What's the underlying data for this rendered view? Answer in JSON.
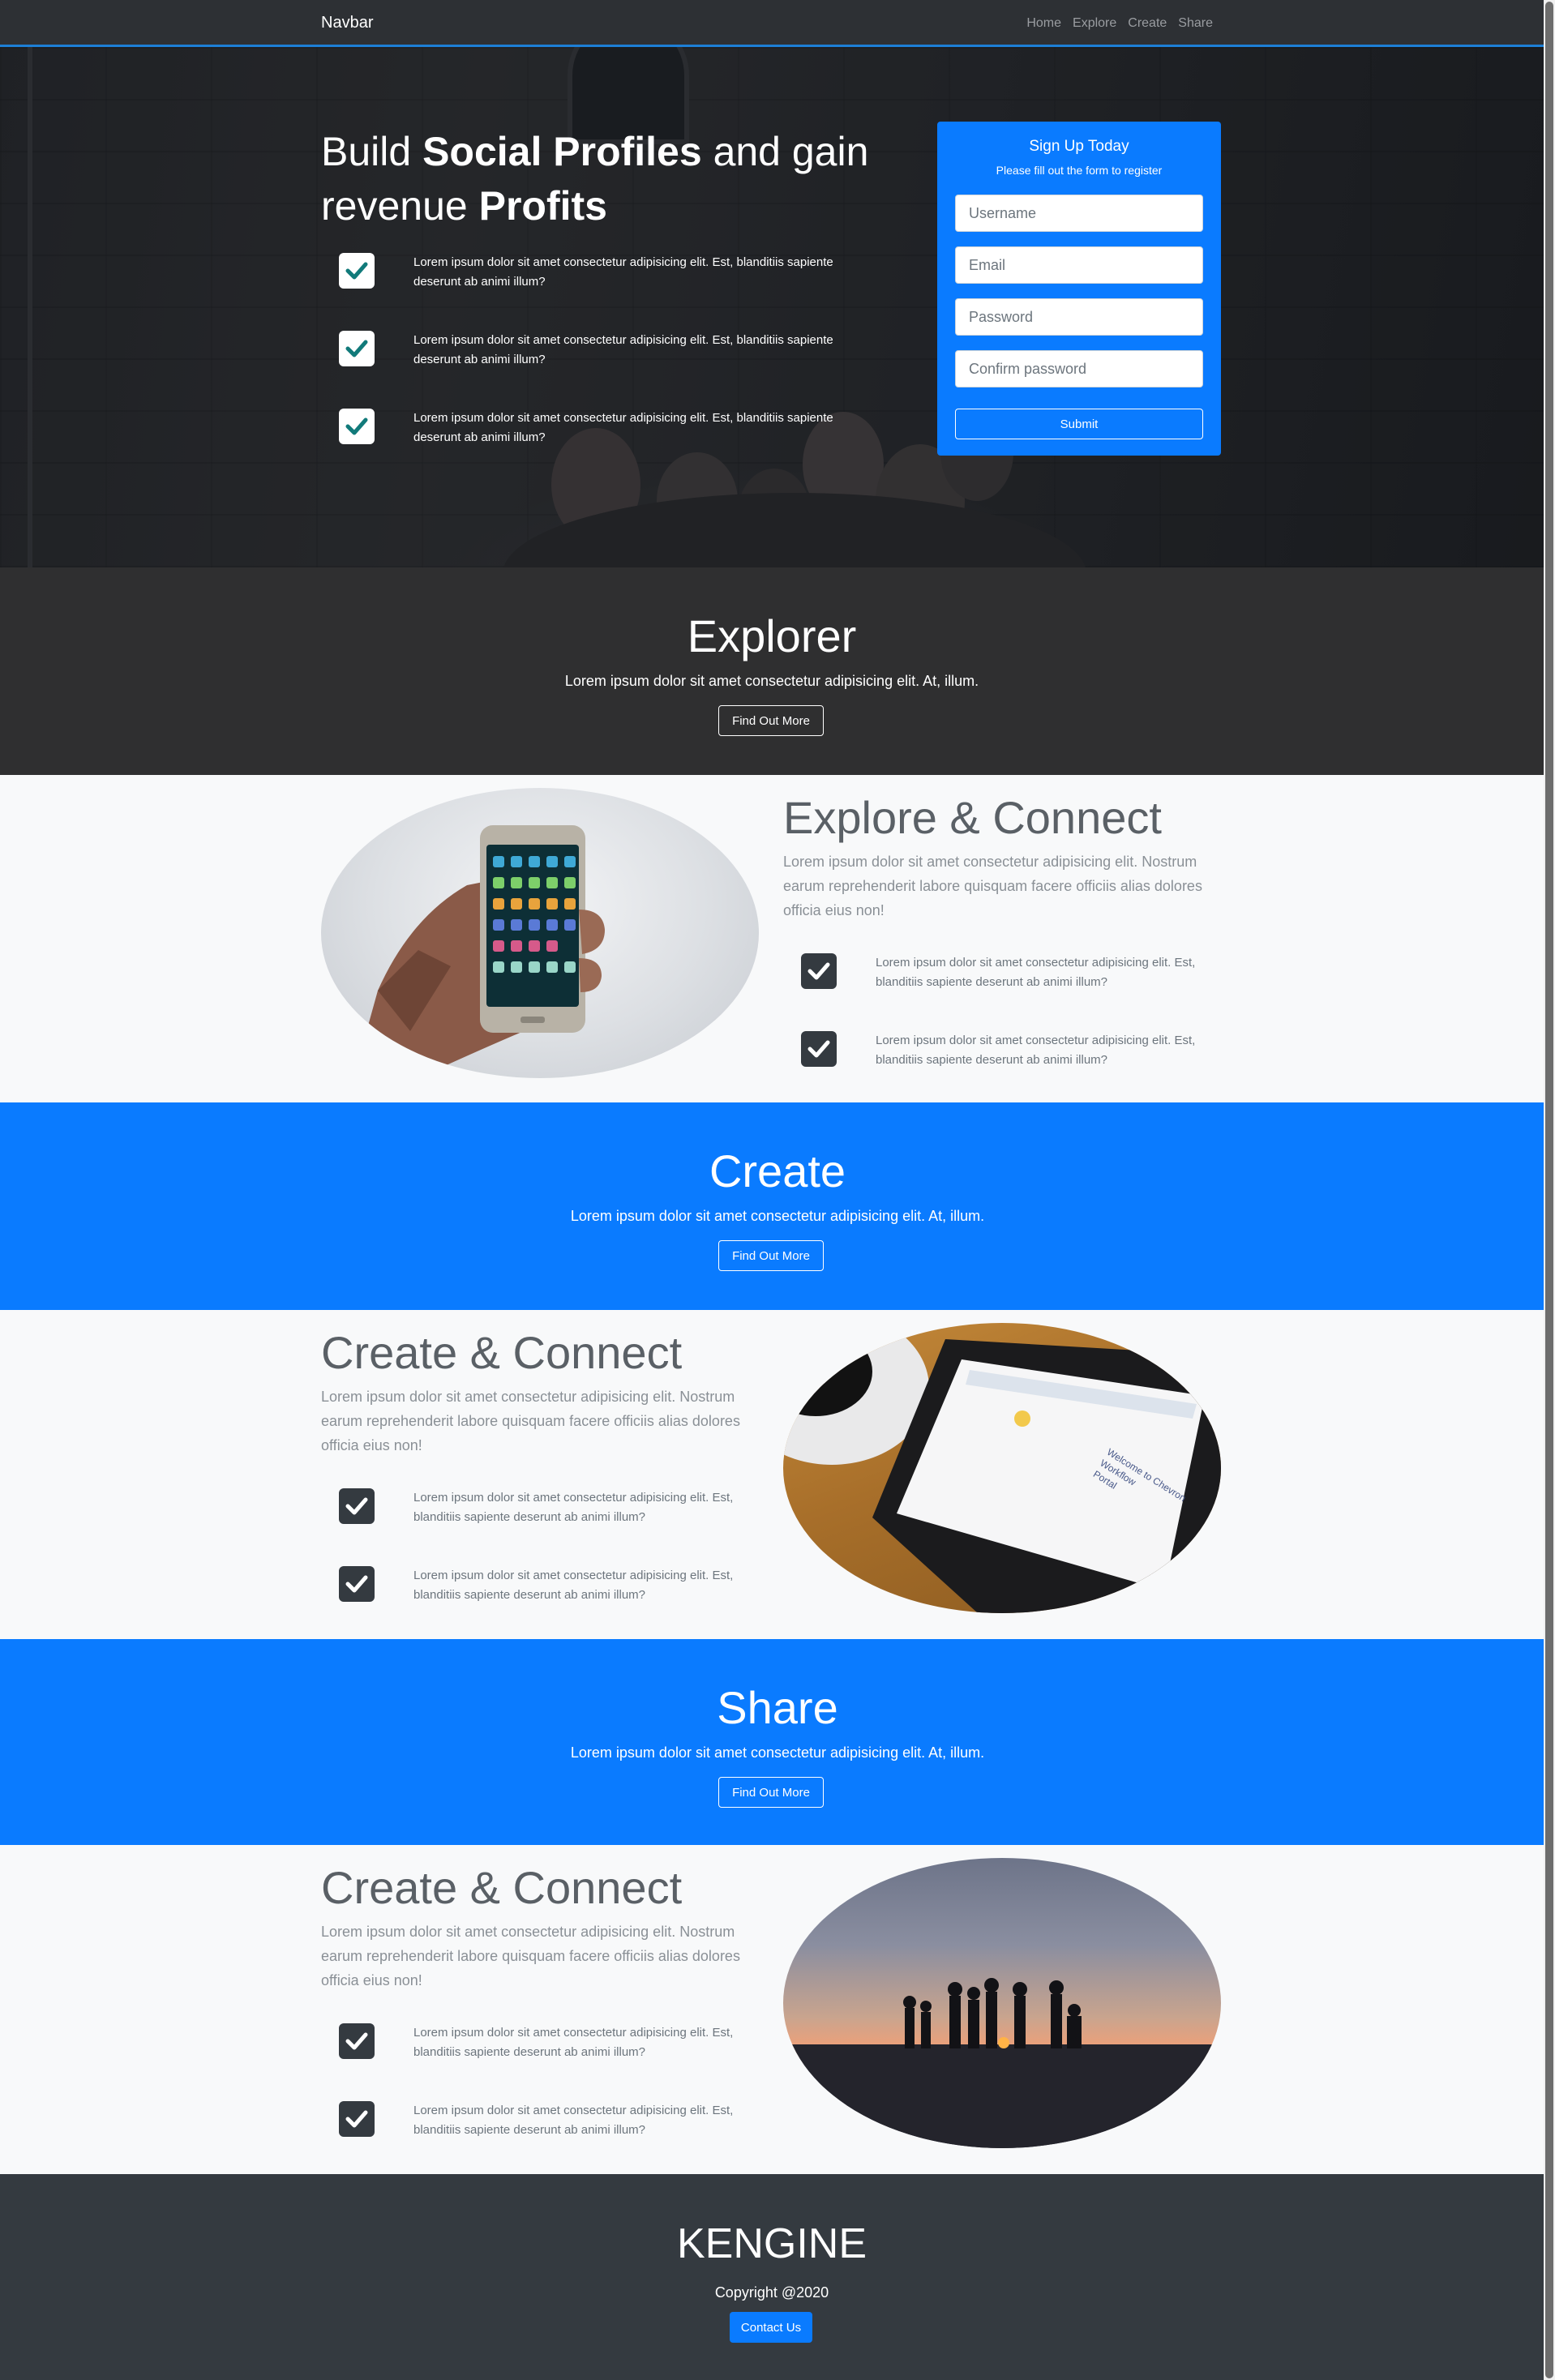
{
  "navbar": {
    "brand": "Navbar",
    "links": [
      "Home",
      "Explore",
      "Create",
      "Share"
    ]
  },
  "hero": {
    "title_part1": "Build ",
    "title_bold1": "Social Profiles",
    "title_part2": " and gain revenue ",
    "title_bold2": "Profits",
    "items": [
      "Lorem ipsum dolor sit amet consectetur adipisicing elit. Est, blanditiis sapiente deserunt ab animi illum?",
      "Lorem ipsum dolor sit amet consectetur adipisicing elit. Est, blanditiis sapiente deserunt ab animi illum?",
      "Lorem ipsum dolor sit amet consectetur adipisicing elit. Est, blanditiis sapiente deserunt ab animi illum?"
    ]
  },
  "signup": {
    "title": "Sign Up Today",
    "subtitle": "Please fill out the form to register",
    "username_placeholder": "Username",
    "email_placeholder": "Email",
    "password_placeholder": "Password",
    "confirm_placeholder": "Confirm password",
    "submit_label": "Submit"
  },
  "explorer": {
    "title": "Explorer",
    "lead": "Lorem ipsum dolor sit amet consectetur adipisicing elit. At, illum.",
    "button": "Find Out More"
  },
  "explore_connect": {
    "title": "Explore & Connect",
    "paragraph": "Lorem ipsum dolor sit amet consectetur adipisicing elit. Nostrum earum reprehenderit labore quisquam facere officiis alias dolores officia eius non!",
    "items": [
      "Lorem ipsum dolor sit amet consectetur adipisicing elit. Est, blanditiis sapiente deserunt ab animi illum?",
      "Lorem ipsum dolor sit amet consectetur adipisicing elit. Est, blanditiis sapiente deserunt ab animi illum?"
    ]
  },
  "create": {
    "title": "Create",
    "lead": "Lorem ipsum dolor sit amet consectetur adipisicing elit. At, illum.",
    "button": "Find Out More"
  },
  "create_connect": {
    "title": "Create & Connect",
    "paragraph": "Lorem ipsum dolor sit amet consectetur adipisicing elit. Nostrum earum reprehenderit labore quisquam facere officiis alias dolores officia eius non!",
    "items": [
      "Lorem ipsum dolor sit amet consectetur adipisicing elit. Est, blanditiis sapiente deserunt ab animi illum?",
      "Lorem ipsum dolor sit amet consectetur adipisicing elit. Est, blanditiis sapiente deserunt ab animi illum?"
    ]
  },
  "share": {
    "title": "Share",
    "lead": "Lorem ipsum dolor sit amet consectetur adipisicing elit. At, illum.",
    "button": "Find Out More"
  },
  "create_connect_2": {
    "title": "Create & Connect",
    "paragraph": "Lorem ipsum dolor sit amet consectetur adipisicing elit. Nostrum earum reprehenderit labore quisquam facere officiis alias dolores officia eius non!",
    "items": [
      "Lorem ipsum dolor sit amet consectetur adipisicing elit. Est, blanditiis sapiente deserunt ab animi illum?",
      "Lorem ipsum dolor sit amet consectetur adipisicing elit. Est, blanditiis sapiente deserunt ab animi illum?"
    ]
  },
  "tablet_screen": {
    "line1": "Welcome to Chevron Workflow",
    "line2": "Portal"
  },
  "footer": {
    "brand": "KENGINE",
    "copyright": "Copyright @2020",
    "contact_button": "Contact Us"
  },
  "colors": {
    "primary": "#0a7bff",
    "dark": "#343a40",
    "band_dark": "#2f2f30",
    "light_bg": "#f8f9fa",
    "check_teal": "#117a7a"
  }
}
